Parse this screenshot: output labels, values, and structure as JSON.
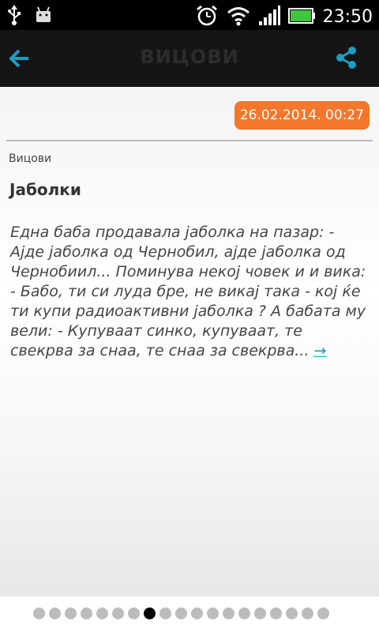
{
  "status_bar": {
    "time": "23:50",
    "icons": [
      "usb-icon",
      "android-debug-icon",
      "alarm-icon",
      "wifi-icon",
      "signal-icon",
      "battery-icon"
    ]
  },
  "action_bar": {
    "title": "ВИЦОВИ",
    "back_icon": "arrow-left-icon",
    "share_icon": "share-icon",
    "accent_color": "#1e9dc0"
  },
  "article": {
    "date": "26.02.2014. 00:27",
    "category": "Вицови",
    "title": "Јаболки",
    "body": "Една баба продавала јаболка на пазар: - Ајде јаболка од Чернобил, ајде јаболка од Чернобиил... Поминува некој човек и и вика: - Бабо, ти си луда бре, не викај така - кој ќе ти купи радиоактивни јаболка ? А бабата му вели: - Купуваат синко, купуваат, те свекрва за снаа, те снаа за свекрва...",
    "more_link": "→",
    "badge_color": "#f4772c"
  },
  "pager": {
    "total": 19,
    "active_index": 7
  }
}
